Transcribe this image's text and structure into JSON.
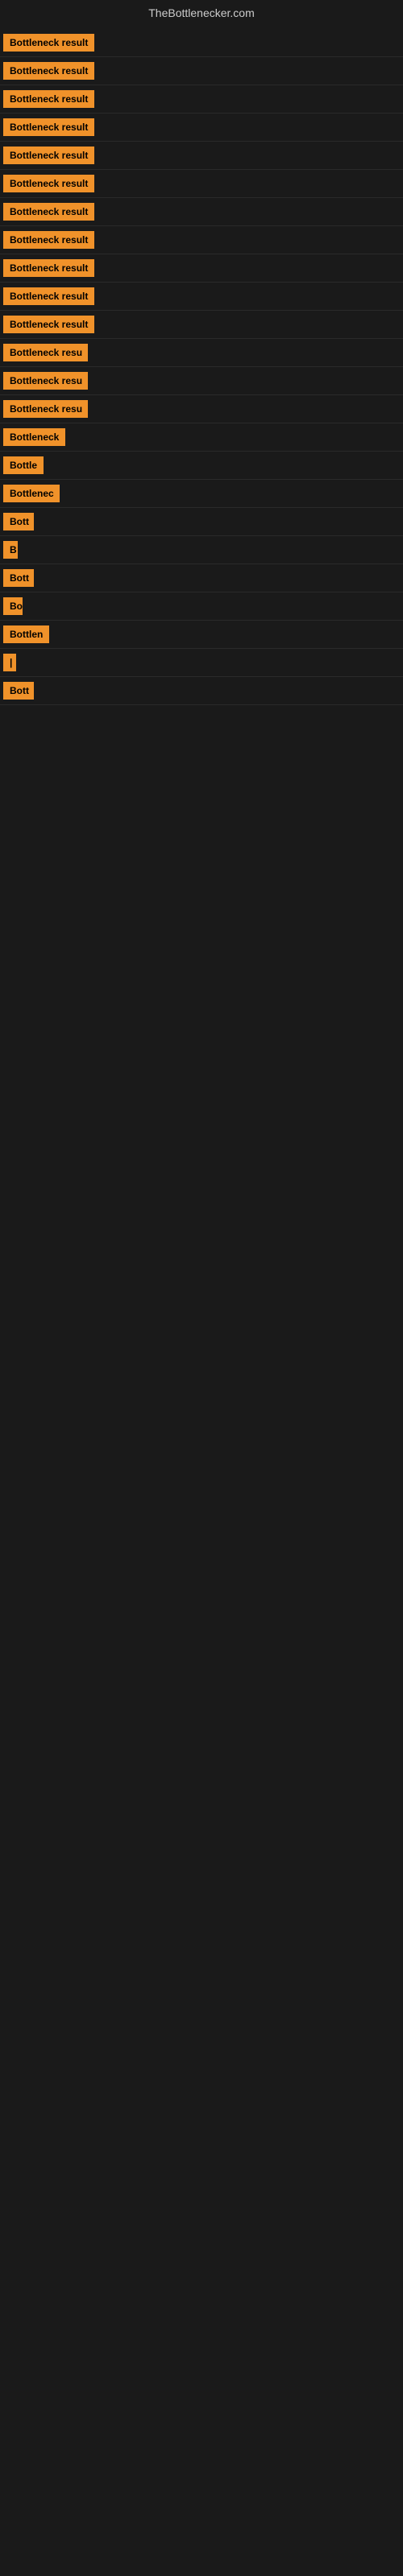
{
  "header": {
    "title": "TheBottlenecker.com"
  },
  "items": [
    {
      "id": 1,
      "label": "Bottleneck result",
      "badge_width": 120
    },
    {
      "id": 2,
      "label": "Bottleneck result",
      "badge_width": 120
    },
    {
      "id": 3,
      "label": "Bottleneck result",
      "badge_width": 120
    },
    {
      "id": 4,
      "label": "Bottleneck result",
      "badge_width": 120
    },
    {
      "id": 5,
      "label": "Bottleneck result",
      "badge_width": 120
    },
    {
      "id": 6,
      "label": "Bottleneck result",
      "badge_width": 120
    },
    {
      "id": 7,
      "label": "Bottleneck result",
      "badge_width": 120
    },
    {
      "id": 8,
      "label": "Bottleneck result",
      "badge_width": 120
    },
    {
      "id": 9,
      "label": "Bottleneck result",
      "badge_width": 120
    },
    {
      "id": 10,
      "label": "Bottleneck result",
      "badge_width": 120
    },
    {
      "id": 11,
      "label": "Bottleneck result",
      "badge_width": 120
    },
    {
      "id": 12,
      "label": "Bottleneck resu",
      "badge_width": 105
    },
    {
      "id": 13,
      "label": "Bottleneck resu",
      "badge_width": 105
    },
    {
      "id": 14,
      "label": "Bottleneck resu",
      "badge_width": 105
    },
    {
      "id": 15,
      "label": "Bottleneck",
      "badge_width": 80
    },
    {
      "id": 16,
      "label": "Bottle",
      "badge_width": 50
    },
    {
      "id": 17,
      "label": "Bottlenec",
      "badge_width": 70
    },
    {
      "id": 18,
      "label": "Bott",
      "badge_width": 38
    },
    {
      "id": 19,
      "label": "B",
      "badge_width": 18
    },
    {
      "id": 20,
      "label": "Bott",
      "badge_width": 38
    },
    {
      "id": 21,
      "label": "Bo",
      "badge_width": 24
    },
    {
      "id": 22,
      "label": "Bottlen",
      "badge_width": 58
    },
    {
      "id": 23,
      "label": "|",
      "badge_width": 12
    },
    {
      "id": 24,
      "label": "Bott",
      "badge_width": 38
    }
  ]
}
